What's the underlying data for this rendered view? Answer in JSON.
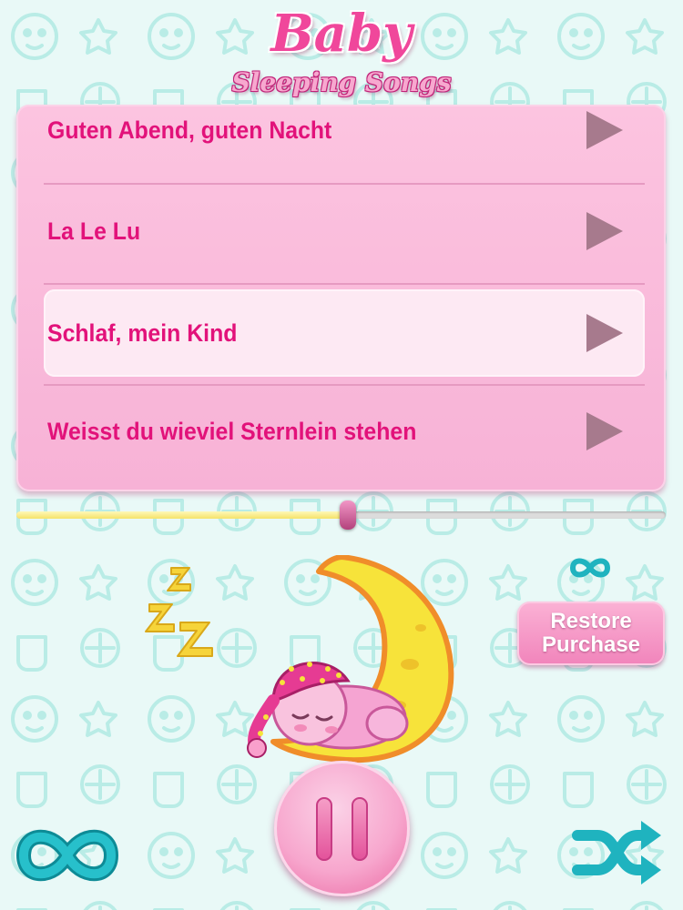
{
  "app": {
    "title": "Baby",
    "subtitle": "Sleeping Songs"
  },
  "songs": [
    {
      "label": "Guten Abend, guten Nacht",
      "selected": false
    },
    {
      "label": "La Le Lu",
      "selected": false
    },
    {
      "label": "Schlaf, mein Kind",
      "selected": true
    },
    {
      "label": "Weisst du wieviel Sternlein stehen",
      "selected": false
    }
  ],
  "player": {
    "progress_fraction": 0.51,
    "state": "playing",
    "pause_icon": "pause-icon",
    "repeat_icon": "infinity-icon",
    "shuffle_icon": "shuffle-icon",
    "loop_indicator_icon": "infinity-icon"
  },
  "restore_purchase": {
    "line1": "Restore",
    "line2": "Purchase"
  },
  "colors": {
    "accent": "#e2127a",
    "panel": "#f7b2d6",
    "selected_row": "#fde9f3",
    "teal_icons": "#1fb3bf",
    "moon": "#f8e23a"
  }
}
